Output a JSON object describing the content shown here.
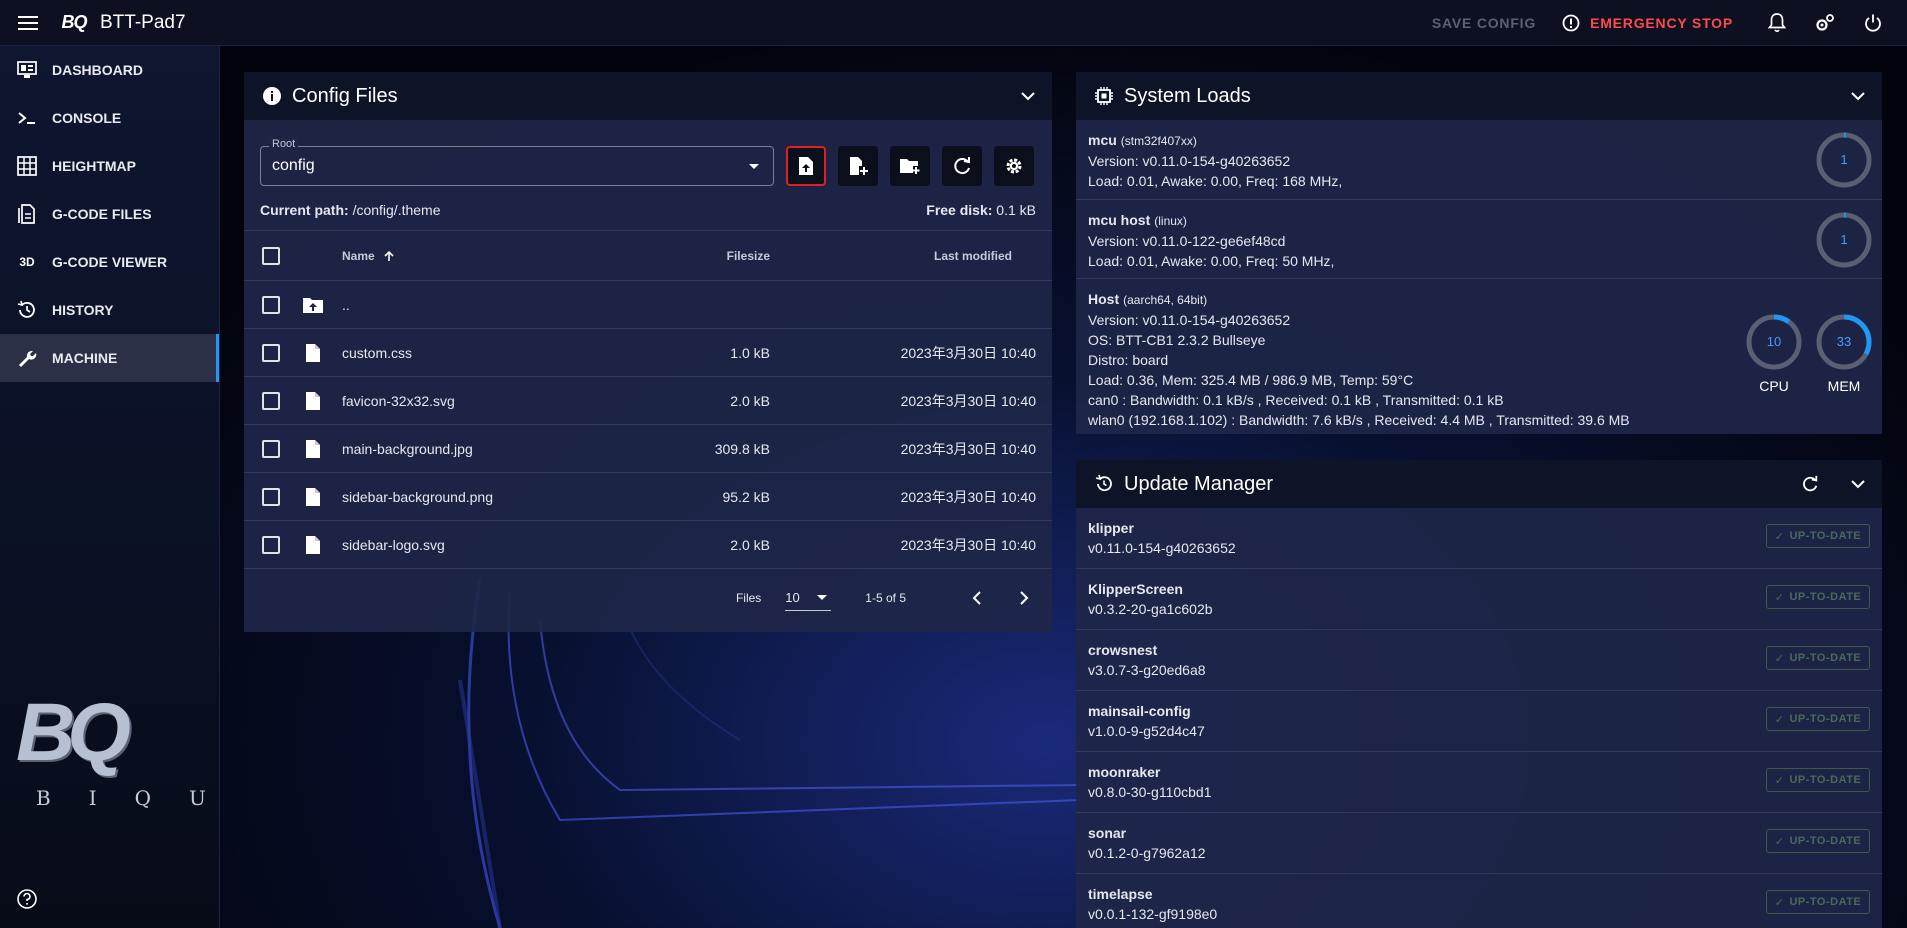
{
  "topbar": {
    "logo_text": "BQ",
    "title": "BTT-Pad7",
    "save_config": "SAVE CONFIG",
    "emergency_stop": "EMERGENCY STOP"
  },
  "sidebar": {
    "items": [
      {
        "label": "DASHBOARD",
        "icon": "monitor-dashboard-icon"
      },
      {
        "label": "CONSOLE",
        "icon": "console-icon"
      },
      {
        "label": "HEIGHTMAP",
        "icon": "grid-icon"
      },
      {
        "label": "G-CODE FILES",
        "icon": "file-document-icon"
      },
      {
        "label": "G-CODE VIEWER",
        "icon": "3d-icon"
      },
      {
        "label": "HISTORY",
        "icon": "history-icon"
      },
      {
        "label": "MACHINE",
        "icon": "wrench-icon"
      }
    ],
    "logo_mark": "BQ",
    "logo_sub": "BIQU"
  },
  "config_files": {
    "title": "Config Files",
    "root_label": "Root",
    "root_value": "config",
    "current_path_label": "Current path:",
    "current_path": "/config/.theme",
    "free_disk_label": "Free disk:",
    "free_disk": "0.1 kB",
    "columns": {
      "name": "Name",
      "size": "Filesize",
      "modified": "Last modified"
    },
    "parent_dir": "..",
    "files": [
      {
        "name": "custom.css",
        "size": "1.0 kB",
        "modified": "2023年3月30日 10:40"
      },
      {
        "name": "favicon-32x32.svg",
        "size": "2.0 kB",
        "modified": "2023年3月30日 10:40"
      },
      {
        "name": "main-background.jpg",
        "size": "309.8 kB",
        "modified": "2023年3月30日 10:40"
      },
      {
        "name": "sidebar-background.png",
        "size": "95.2 kB",
        "modified": "2023年3月30日 10:40"
      },
      {
        "name": "sidebar-logo.svg",
        "size": "2.0 kB",
        "modified": "2023年3月30日 10:40"
      }
    ],
    "footer": {
      "files_label": "Files",
      "per_page": "10",
      "range": "1-5 of 5"
    }
  },
  "system_loads": {
    "title": "System Loads",
    "mcus": [
      {
        "name": "mcu",
        "chip": "(stm32f407xx)",
        "lines": [
          "Version: v0.11.0-154-g40263652",
          "Load: 0.01, Awake: 0.00, Freq: 168 MHz,"
        ],
        "gauge": "1"
      },
      {
        "name": "mcu host",
        "chip": "(linux)",
        "lines": [
          "Version: v0.11.0-122-ge6ef48cd",
          "Load: 0.01, Awake: 0.00, Freq: 50 MHz,"
        ],
        "gauge": "1"
      }
    ],
    "host": {
      "name": "Host",
      "chip": "(aarch64, 64bit)",
      "lines": [
        "Version: v0.11.0-154-g40263652",
        "OS: BTT-CB1 2.3.2 Bullseye",
        "Distro: board",
        "Load: 0.36, Mem: 325.4 MB / 986.9 MB, Temp: 59°C",
        "can0 : Bandwidth: 0.1 kB/s , Received: 0.1 kB , Transmitted: 0.1 kB",
        "wlan0 (192.168.1.102) : Bandwidth: 7.6 kB/s , Received: 4.4 MB , Transmitted: 39.6 MB"
      ],
      "cpu": {
        "value": "10",
        "label": "CPU",
        "percent": 10
      },
      "mem": {
        "value": "33",
        "label": "MEM",
        "percent": 33
      }
    }
  },
  "update_manager": {
    "title": "Update Manager",
    "badge": "UP-TO-DATE",
    "items": [
      {
        "name": "klipper",
        "version": "v0.11.0-154-g40263652"
      },
      {
        "name": "KlipperScreen",
        "version": "v0.3.2-20-ga1c602b"
      },
      {
        "name": "crowsnest",
        "version": "v3.0.7-3-g20ed6a8"
      },
      {
        "name": "mainsail-config",
        "version": "v1.0.0-9-g52d4c47"
      },
      {
        "name": "moonraker",
        "version": "v0.8.0-30-g110cbd1"
      },
      {
        "name": "sonar",
        "version": "v0.1.2-0-g7962a12"
      },
      {
        "name": "timelapse",
        "version": "v0.0.1-132-gf9198e0"
      }
    ]
  },
  "colors": {
    "accent": "#2196f3",
    "emergency": "#ff4a4a",
    "badge": "#3d5a4a"
  }
}
